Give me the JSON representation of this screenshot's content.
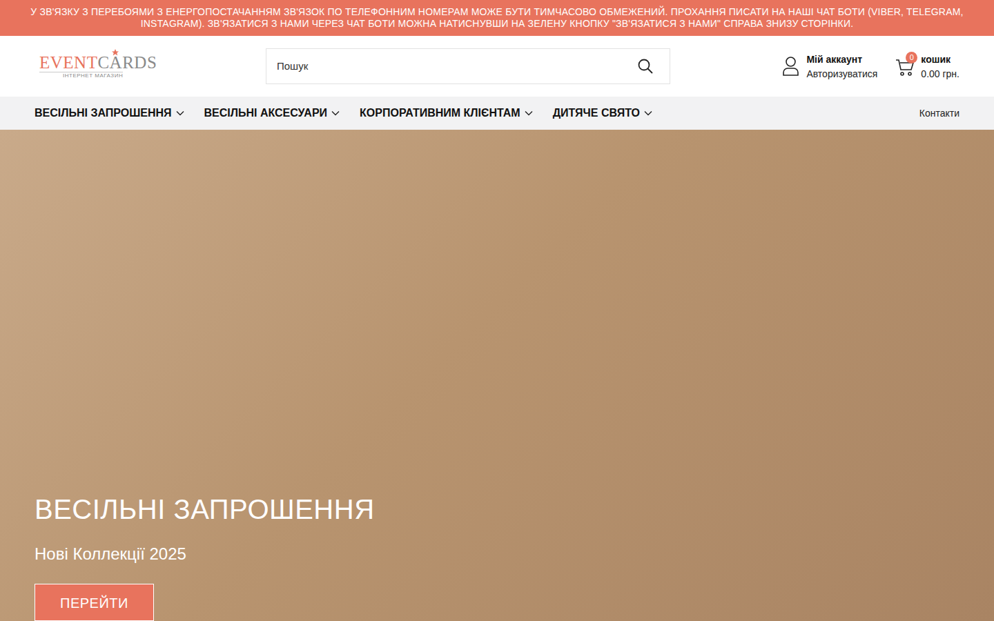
{
  "banner": {
    "text": "У ЗВ'ЯЗКУ З ПЕРЕБОЯМИ З ЕНЕРГОПОСТАЧАННЯМ ЗВ'ЯЗОК ПО ТЕЛЕФОННИМ НОМЕРАМ МОЖЕ БУТИ ТИМЧАСОВО ОБМЕЖЕНИЙ. ПРОХАННЯ ПИСАТИ НА НАШІ ЧАТ БОТИ (VIBER, TELEGRAM, INSTAGRAM). ЗВ'ЯЗАТИСЯ З НАМИ ЧЕРЕЗ ЧАТ БОТИ МОЖНА НАТИСНУВШИ НА ЗЕЛЕНУ КНОПКУ \"ЗВ'ЯЗАТИСЯ З НАМИ\" СПРАВА ЗНИЗУ СТОРІНКИ."
  },
  "logo": {
    "part1": "EVENT",
    "part2": "CARDS",
    "subtitle": "ІНТЕРНЕТ МАГАЗИН"
  },
  "search": {
    "placeholder": "Пошук"
  },
  "account": {
    "title": "Мій аккаунт",
    "action": "Авторизуватися"
  },
  "cart": {
    "count": "0",
    "title": "кошик",
    "total": "0.00 грн."
  },
  "nav": {
    "items": [
      {
        "label": "ВЕСІЛЬНІ ЗАПРОШЕННЯ"
      },
      {
        "label": "ВЕСІЛЬНІ АКСЕСУАРИ"
      },
      {
        "label": "КОРПОРАТИВНИМ КЛІЄНТАМ"
      },
      {
        "label": "ДИТЯЧЕ СВЯТО"
      }
    ],
    "contacts": "Контакти"
  },
  "hero": {
    "title": "ВЕСІЛЬНІ ЗАПРОШЕННЯ",
    "subtitle": "Нові Коллекції 2025",
    "button": "ПЕРЕЙТИ"
  }
}
